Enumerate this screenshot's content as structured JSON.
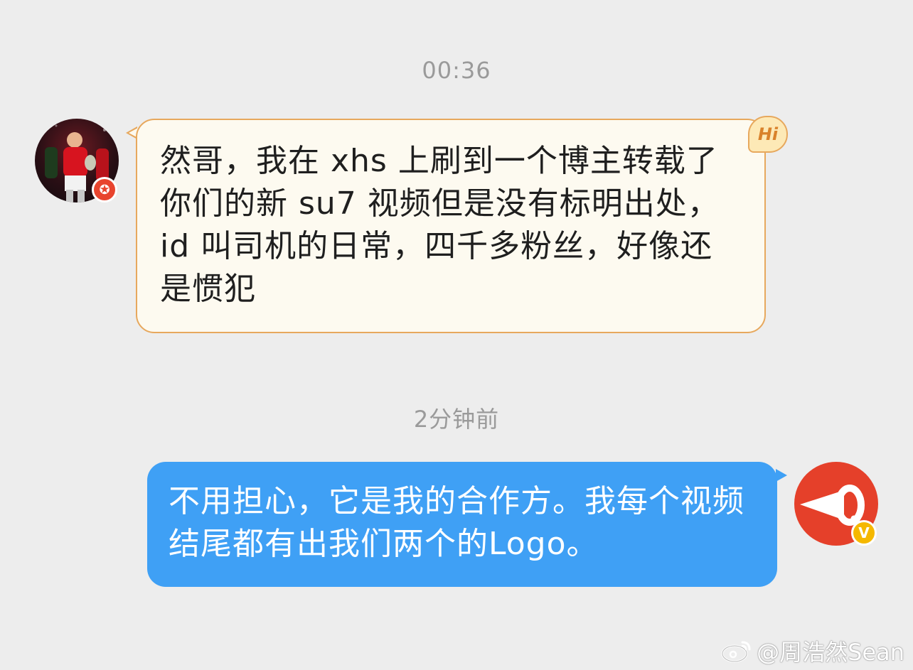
{
  "conversation": {
    "timestamps": [
      "00:36",
      "2分钟前"
    ],
    "incoming": {
      "avatar": "football-player-avatar",
      "badge_icon": "star-badge-icon",
      "sticker": "Hi",
      "text": "然哥，我在 xhs 上刷到一个博主转载了你们的新 su7 视频但是没有标明出处，id 叫司机的日常，四千多粉丝，好像还是惯犯"
    },
    "outgoing": {
      "avatar": "megaphone-logo-avatar",
      "badge": "V",
      "text": "不用担心，它是我的合作方。我每个视频结尾都有出我们两个的Logo。"
    }
  },
  "watermark": {
    "icon": "weibo-icon",
    "text": "@周浩然Sean"
  },
  "colors": {
    "background": "#ededed",
    "incoming_bubble": "#fdfaf0",
    "incoming_border": "#e7a85d",
    "outgoing_bubble": "#3fa0f5",
    "badge_red": "#e8442e",
    "badge_gold": "#f5b800"
  }
}
